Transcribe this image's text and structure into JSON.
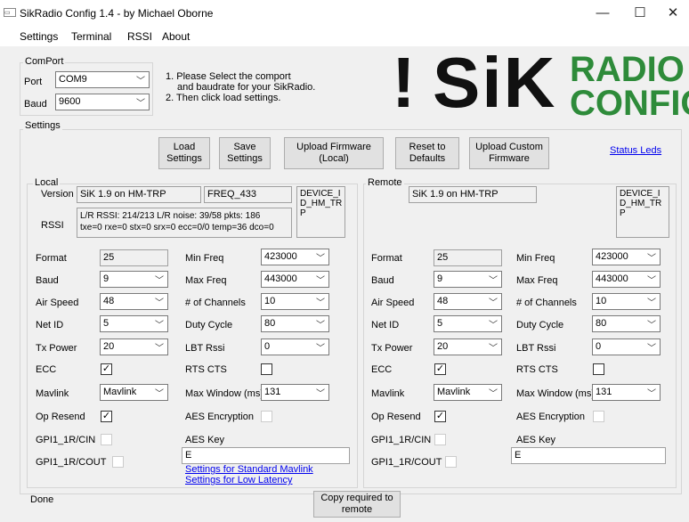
{
  "window": {
    "title": "SikRadio Config 1.4 - by Michael Oborne",
    "icon": "app-icon",
    "min": "—",
    "max": "☐",
    "close": "✕"
  },
  "menu": [
    "Settings",
    "Terminal",
    "RSSI",
    "About"
  ],
  "comport": {
    "group": "ComPort",
    "port_label": "Port",
    "port": "COM9",
    "baud_label": "Baud",
    "baud": "9600",
    "instr1": "1. Please Select the comport",
    "instr1b": "and baudrate for your SikRadio.",
    "instr2": "2. Then click load settings."
  },
  "logo": {
    "bar": "!",
    "sik": "SiK",
    "radio": "RADIO",
    "config": "CONFIG"
  },
  "settings_group": "Settings",
  "buttons": {
    "load": "Load Settings",
    "save": "Save Settings",
    "upload": "Upload Firmware (Local)",
    "reset": "Reset to Defaults",
    "custom": "Upload Custom Firmware",
    "status_leds": "Status Leds",
    "copy": "Copy required to remote"
  },
  "local": {
    "group": "Local",
    "version_label": "Version",
    "version": "SiK 1.9 on HM-TRP",
    "freq": "FREQ_433",
    "device": "DEVICE_I D_HM_TR P",
    "rssi_label": "RSSI",
    "rssi1": "L/R RSSI: 214/213  L/R noise: 39/58 pkts: 186",
    "rssi2": "txe=0 rxe=0 stx=0 srx=0 ecc=0/0 temp=36 dco=0",
    "format": "25",
    "baud": "9",
    "airspeed": "48",
    "netid": "5",
    "txpower": "20",
    "mavlink": "Mavlink",
    "minfreq": "423000",
    "maxfreq": "443000",
    "channels": "10",
    "duty": "80",
    "lbt": "0",
    "maxwindow": "131",
    "aeskey": "E",
    "link1": "Settings for Standard Mavlink",
    "link2": "Settings for Low Latency"
  },
  "remote": {
    "group": "Remote",
    "version": "SiK 1.9 on HM-TRP",
    "device": "DEVICE_I D_HM_TR P",
    "format": "25",
    "baud": "9",
    "airspeed": "48",
    "netid": "5",
    "txpower": "20",
    "mavlink": "Mavlink",
    "minfreq": "423000",
    "maxfreq": "443000",
    "channels": "10",
    "duty": "80",
    "lbt": "0",
    "maxwindow": "131",
    "aeskey": "E"
  },
  "labels": {
    "format": "Format",
    "baud": "Baud",
    "airspeed": "Air Speed",
    "netid": "Net ID",
    "txpower": "Tx Power",
    "ecc": "ECC",
    "mavlink": "Mavlink",
    "opresend": "Op Resend",
    "gpi_cin": "GPI1_1R/CIN",
    "gpi_cout": "GPI1_1R/COUT",
    "minfreq": "Min Freq",
    "maxfreq": "Max Freq",
    "channels": "# of Channels",
    "duty": "Duty Cycle",
    "lbt": "LBT Rssi",
    "rtscts": "RTS CTS",
    "maxwindow": "Max Window (ms)",
    "aes": "AES Encryption",
    "aeskey": "AES Key"
  },
  "status": "Done",
  "colors": {
    "logo_black": "#111111",
    "logo_green": "#2e8b3a"
  }
}
